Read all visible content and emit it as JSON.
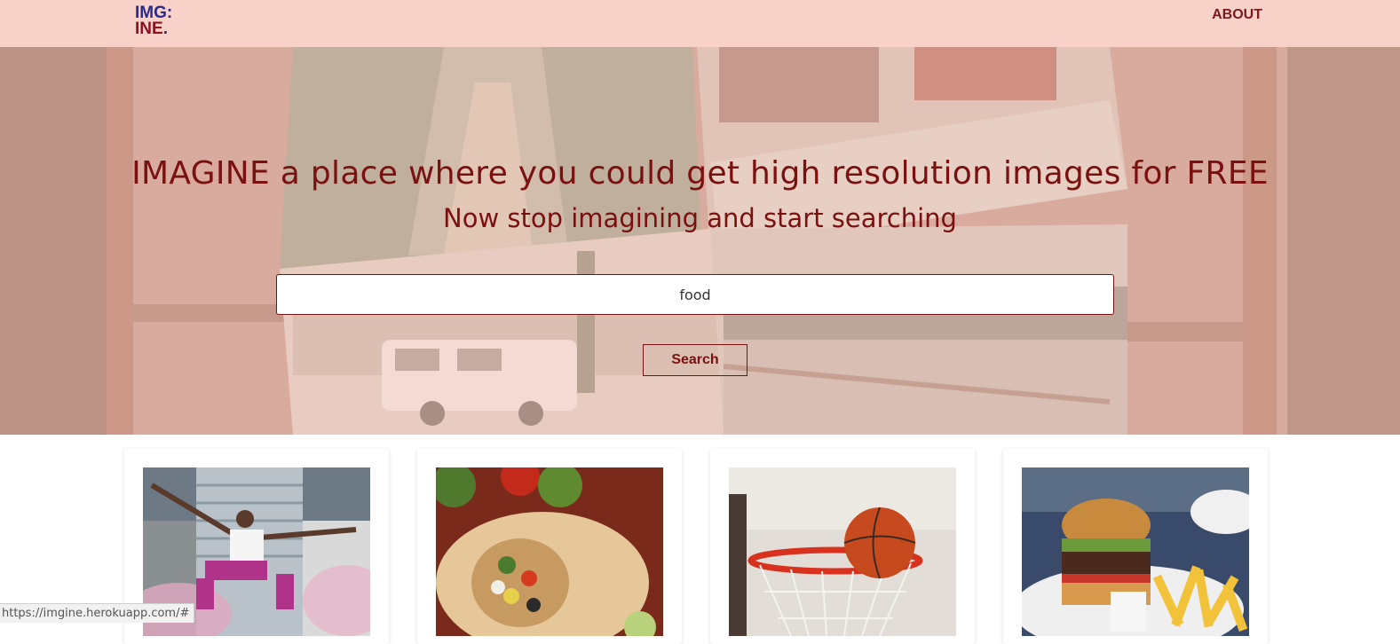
{
  "navbar": {
    "logo_line1": "IMG:",
    "logo_line2": "INE.",
    "about_label": "ABOUT"
  },
  "hero": {
    "headline": "IMAGINE a place where you could get high resolution images for FREE",
    "subheadline": "Now stop imagining and start searching"
  },
  "search": {
    "value": "food",
    "button_label": "Search"
  },
  "results": [
    {
      "icon": "person-jumping-image"
    },
    {
      "icon": "burrito-image"
    },
    {
      "icon": "basketball-hoop-image"
    },
    {
      "icon": "burger-fries-image"
    }
  ],
  "status_bar": {
    "url": "https://imgine.herokuapp.com/#"
  },
  "colors": {
    "navbar_bg": "#f8d1c8",
    "accent": "#7a1010",
    "logo_blue": "#2a2a8a"
  }
}
